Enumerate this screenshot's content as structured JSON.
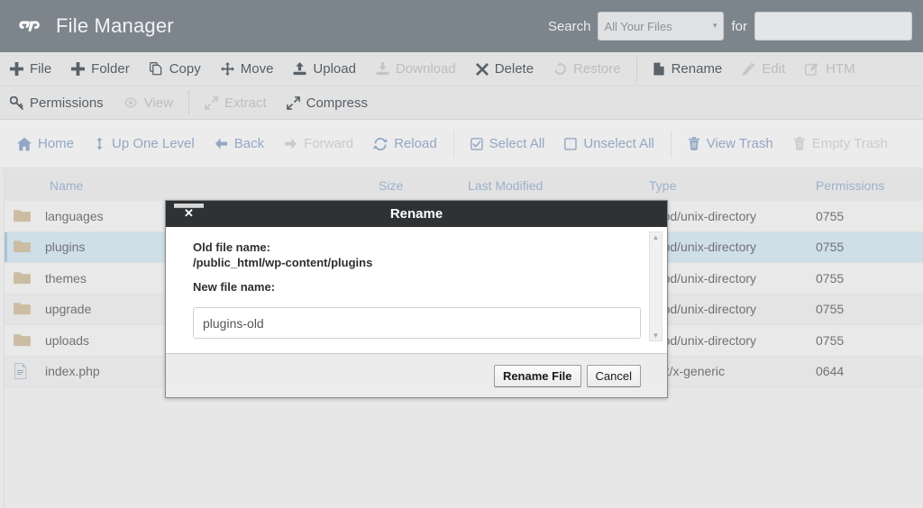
{
  "header": {
    "logo": "cpanel-logo",
    "title": "File Manager",
    "search_label": "Search",
    "search_scope": "All Your Files",
    "for_label": "for",
    "search_value": "",
    "search_placeholder": ""
  },
  "toolbar_row1": [
    {
      "label": "File",
      "icon": "plus-icon",
      "disabled": false
    },
    {
      "label": "Folder",
      "icon": "plus-icon",
      "disabled": false
    },
    {
      "label": "Copy",
      "icon": "copy-icon",
      "disabled": false
    },
    {
      "label": "Move",
      "icon": "move-icon",
      "disabled": false
    },
    {
      "label": "Upload",
      "icon": "upload-icon",
      "disabled": false
    },
    {
      "label": "Download",
      "icon": "download-icon",
      "disabled": true
    },
    {
      "label": "Delete",
      "icon": "delete-x-icon",
      "disabled": false
    },
    {
      "label": "Restore",
      "icon": "restore-icon",
      "disabled": true
    },
    {
      "label": "Rename",
      "icon": "file-icon",
      "disabled": false
    },
    {
      "label": "Edit",
      "icon": "pencil-icon",
      "disabled": true
    },
    {
      "label": "HTM",
      "icon": "html-edit-icon",
      "disabled": true
    }
  ],
  "toolbar_row2": [
    {
      "label": "Permissions",
      "icon": "key-icon",
      "disabled": false
    },
    {
      "label": "View",
      "icon": "eye-icon",
      "disabled": true
    },
    {
      "label": "Extract",
      "icon": "extract-icon",
      "disabled": true
    },
    {
      "label": "Compress",
      "icon": "compress-icon",
      "disabled": false
    }
  ],
  "navbar": [
    {
      "label": "Home",
      "icon": "home-icon",
      "disabled": false
    },
    {
      "label": "Up One Level",
      "icon": "up-level-icon",
      "disabled": false
    },
    {
      "label": "Back",
      "icon": "arrow-left-icon",
      "disabled": false
    },
    {
      "label": "Forward",
      "icon": "arrow-right-icon",
      "disabled": true
    },
    {
      "label": "Reload",
      "icon": "reload-icon",
      "disabled": false
    },
    {
      "label": "Select All",
      "icon": "checkbox-checked-icon",
      "disabled": false
    },
    {
      "label": "Unselect All",
      "icon": "checkbox-empty-icon",
      "disabled": false
    },
    {
      "label": "View Trash",
      "icon": "trash-icon",
      "disabled": false
    },
    {
      "label": "Empty Trash",
      "icon": "trash-icon",
      "disabled": true
    }
  ],
  "table": {
    "columns": [
      "Name",
      "Size",
      "Last Modified",
      "Type",
      "Permissions"
    ],
    "rows": [
      {
        "icon": "folder-icon",
        "name": "languages",
        "size": "",
        "modified": "",
        "type": "httpd/unix-directory",
        "permissions": "0755",
        "selected": false
      },
      {
        "icon": "folder-icon",
        "name": "plugins",
        "size": "",
        "modified": "",
        "type": "httpd/unix-directory",
        "permissions": "0755",
        "selected": true
      },
      {
        "icon": "folder-icon",
        "name": "themes",
        "size": "",
        "modified": "",
        "type": "httpd/unix-directory",
        "permissions": "0755",
        "selected": false
      },
      {
        "icon": "folder-icon",
        "name": "upgrade",
        "size": "",
        "modified": "",
        "type": "httpd/unix-directory",
        "permissions": "0755",
        "selected": false
      },
      {
        "icon": "folder-icon",
        "name": "uploads",
        "size": "",
        "modified": "",
        "type": "httpd/unix-directory",
        "permissions": "0755",
        "selected": false
      },
      {
        "icon": "file-php-icon",
        "name": "index.php",
        "size": "",
        "modified": "",
        "type": "text/x-generic",
        "permissions": "0644",
        "selected": false
      }
    ]
  },
  "modal": {
    "title": "Rename",
    "close_label": "✕",
    "old_file_label": "Old file name:",
    "old_file_path": "/public_html/wp-content/plugins",
    "new_file_label": "New file name:",
    "new_file_value": "plugins-old",
    "confirm_label": "Rename File",
    "cancel_label": "Cancel",
    "scroll_up": "▲",
    "scroll_down": "▼"
  },
  "colors": {
    "topbar": "#7d858c",
    "toolbar": "#e2e2e2",
    "nav_text": "#93a7c4",
    "row_selected": "#cfdfe8",
    "modal_titlebar": "#2f3234",
    "folder": "#ccbca2"
  }
}
